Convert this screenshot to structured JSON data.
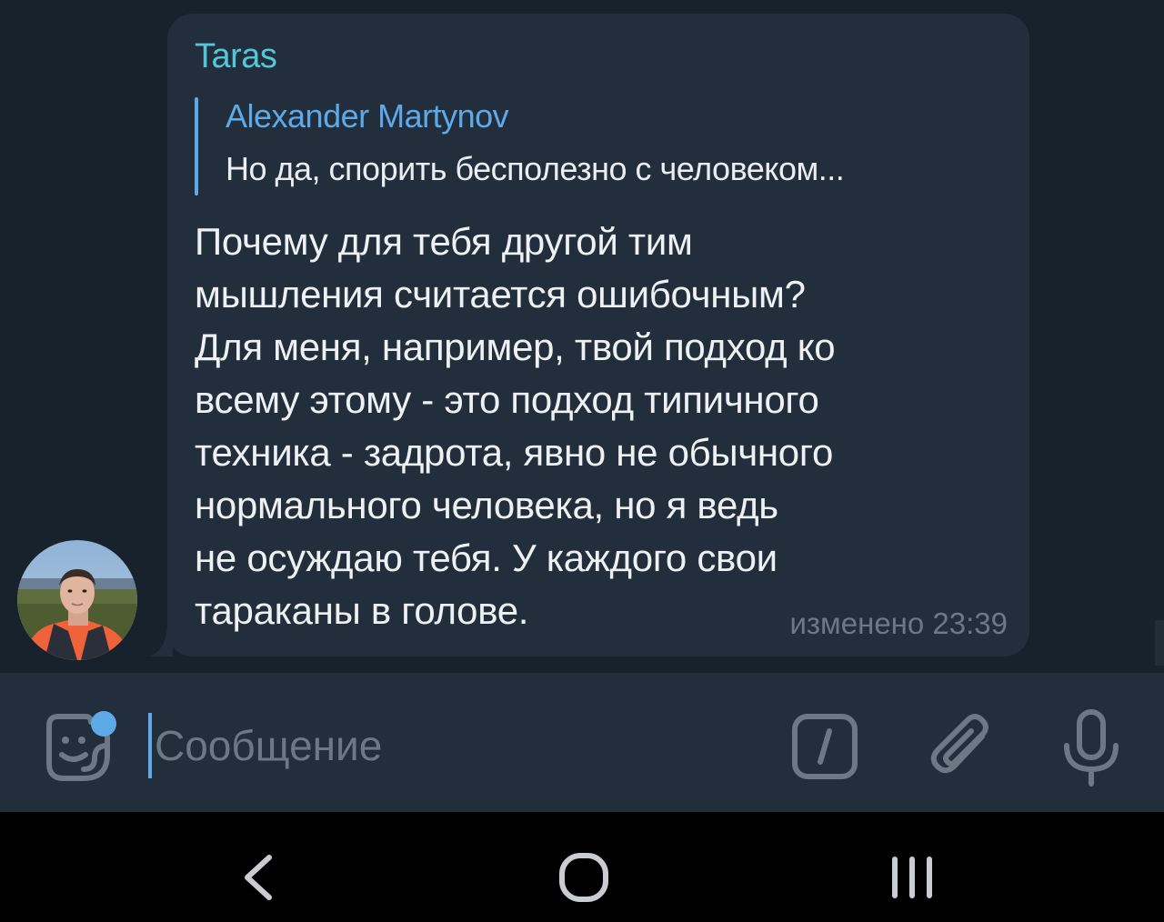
{
  "message": {
    "sender": "Taras",
    "reply": {
      "author": "Alexander Martynov",
      "text": "Но да, спорить бесполезно с человеком..."
    },
    "text": "Почему для тебя другой тим\nмышления считается ошибочным?\nДля меня, например, твой подход ко\nвсему этому - это подход типичного\nтехника - задрота, явно не обычного\nнормального человека, но я ведь\nне осуждаю тебя. У каждого свои\nтараканы в голове.",
    "meta": "изменено 23:39"
  },
  "composer": {
    "placeholder": "Сообщение",
    "value": ""
  },
  "icons": {
    "sticker": "sticker-smile-icon",
    "commands": "slash-commands-icon",
    "attach": "paperclip-icon",
    "mic": "microphone-icon",
    "back": "nav-back-icon",
    "home": "nav-home-icon",
    "recents": "nav-recents-icon"
  },
  "colors": {
    "background": "#18222d",
    "bubble": "#232e3c",
    "sender": "#53c6d8",
    "accent": "#5ea9e7",
    "text": "#eef1f4",
    "muted": "#6c7883",
    "navbar": "#000000"
  }
}
